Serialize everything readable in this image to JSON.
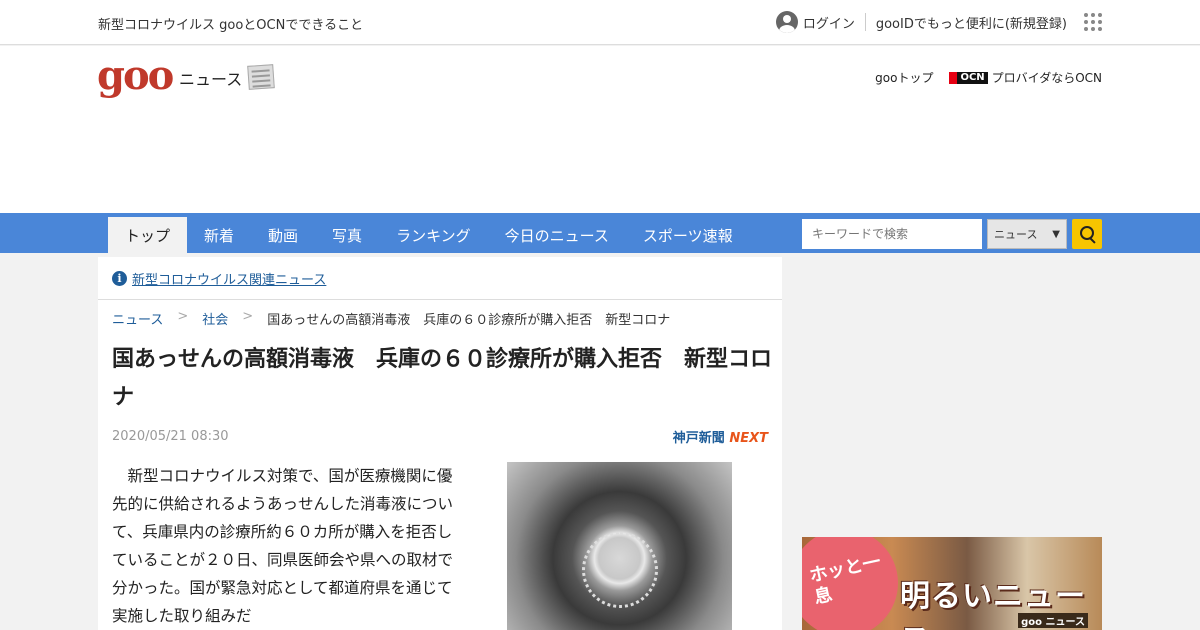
{
  "utilbar": {
    "left_text": "新型コロナウイルス gooとOCNでできること",
    "login": "ログイン",
    "register": "gooIDでもっと便利に(新規登録)"
  },
  "header": {
    "logo": "goo",
    "logo_sub": "ニュース",
    "goo_top": "gooトップ",
    "ocn_mark": "OCN",
    "ocn_link": "プロバイダならOCN"
  },
  "nav": {
    "tabs": [
      "トップ",
      "新着",
      "動画",
      "写真",
      "ランキング",
      "今日のニュース",
      "スポーツ速報"
    ],
    "active_index": 0,
    "search_placeholder": "キーワードで検索",
    "search_scope": "ニュース",
    "accent_color": "#4a86d8"
  },
  "article": {
    "notice": "新型コロナウイルス関連ニュース",
    "breadcrumb": [
      "ニュース",
      "社会",
      "国あっせんの高額消毒液　兵庫の６０診療所が購入拒否　新型コロナ"
    ],
    "title": "国あっせんの高額消毒液　兵庫の６０診療所が購入拒否　新型コロナ",
    "date": "2020/05/21 08:30",
    "source": "神戸新聞",
    "source_suffix": "NEXT",
    "body": "新型コロナウイルス対策で、国が医療機関に優先的に供給されるようあっせんした消毒液について、兵庫県内の診療所約６０カ所が購入を拒否していることが２０日、同県医師会や県への取材で分かった。国が緊急対応として都道府県を通じて実施した取り組みだ"
  },
  "ad": {
    "bubble": "ホッと一息",
    "title": "明るいニュース",
    "brand": "goo ニュース"
  }
}
